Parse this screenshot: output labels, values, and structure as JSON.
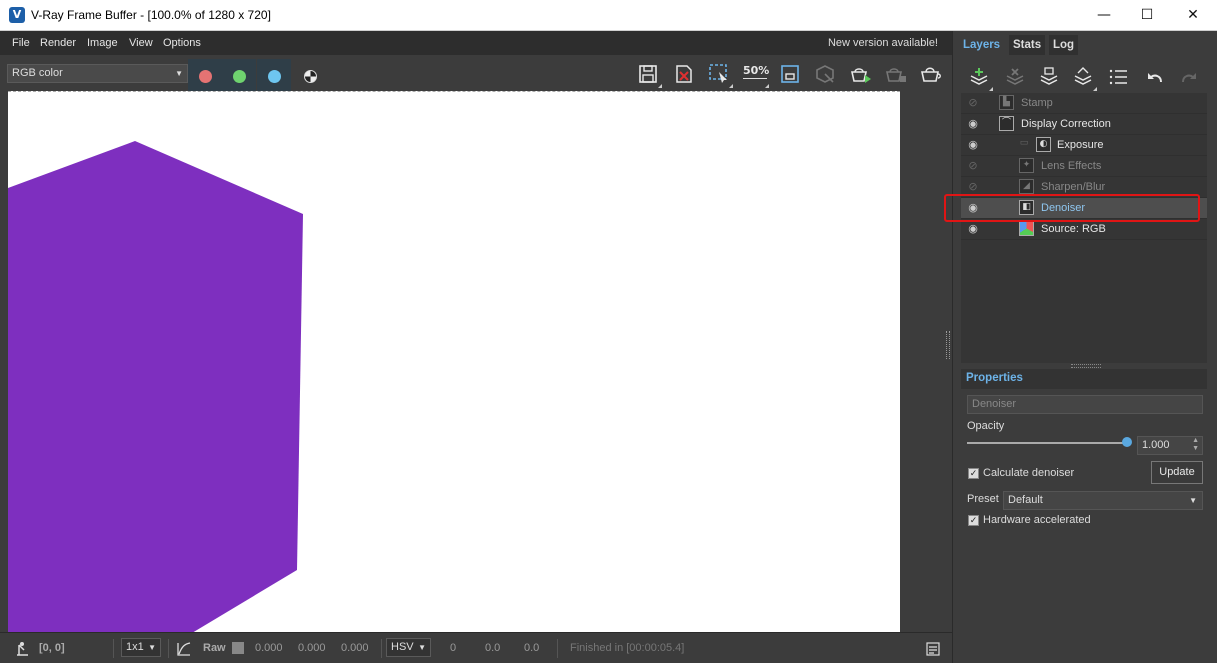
{
  "window": {
    "title": "V-Ray Frame Buffer - [100.0% of 1280 x 720]",
    "app_icon": "V",
    "minimize_glyph": "—",
    "maximize_glyph": "☐",
    "close_glyph": "✕"
  },
  "menu": {
    "items": [
      "File",
      "Render",
      "Image",
      "View",
      "Options"
    ],
    "notice": "New version available!"
  },
  "toolbar": {
    "channel": "RGB color",
    "channel_arrow": "▼",
    "dots": {
      "red": "#e57373",
      "green": "#6fd36f",
      "blue": "#6ec6f0"
    },
    "zoom_icon_text": "50%",
    "icons": [
      "save-icon",
      "clear-image-icon",
      "region-render-icon",
      "follow-mouse-icon",
      "compare-icon",
      "lock-icon",
      "render-icon",
      "render-interactive-icon",
      "stop-render-icon"
    ]
  },
  "image": {
    "shape_color": "#7e2fbf",
    "background_color": "#ffffff"
  },
  "status": {
    "coords": "[0, 0]",
    "sampling": "1x1",
    "raw_label": "Raw",
    "r": "0.000",
    "g": "0.000",
    "b": "0.000",
    "color_mode": "HSV",
    "h": "0",
    "s": "0.0",
    "v": "0.0",
    "message": "Finished in [00:00:05.4]"
  },
  "right_tabs": [
    "Layers",
    "Stats",
    "Log"
  ],
  "layers": [
    {
      "label": "Stamp",
      "visible": false,
      "enabled": false,
      "indent": 0
    },
    {
      "label": "Display Correction",
      "visible": true,
      "enabled": true,
      "indent": 0
    },
    {
      "label": "Exposure",
      "visible": true,
      "enabled": true,
      "indent": 1
    },
    {
      "label": "Lens Effects",
      "visible": false,
      "enabled": false,
      "indent": 1
    },
    {
      "label": "Sharpen/Blur",
      "visible": false,
      "enabled": false,
      "indent": 1
    },
    {
      "label": "Denoiser",
      "visible": true,
      "enabled": true,
      "indent": 1,
      "selected": true
    },
    {
      "label": "Source: RGB",
      "visible": true,
      "enabled": true,
      "indent": 1
    }
  ],
  "properties": {
    "header": "Properties",
    "layer_name": "Denoiser",
    "opacity_label": "Opacity",
    "opacity_value": "1.000",
    "opacity_fraction": 1.0,
    "calculate_denoiser": "Calculate denoiser",
    "update_button": "Update",
    "preset_label": "Preset",
    "preset_value": "Default",
    "hardware_accelerated": "Hardware accelerated",
    "check_glyph": "✓"
  },
  "highlight_color": "#e01515"
}
